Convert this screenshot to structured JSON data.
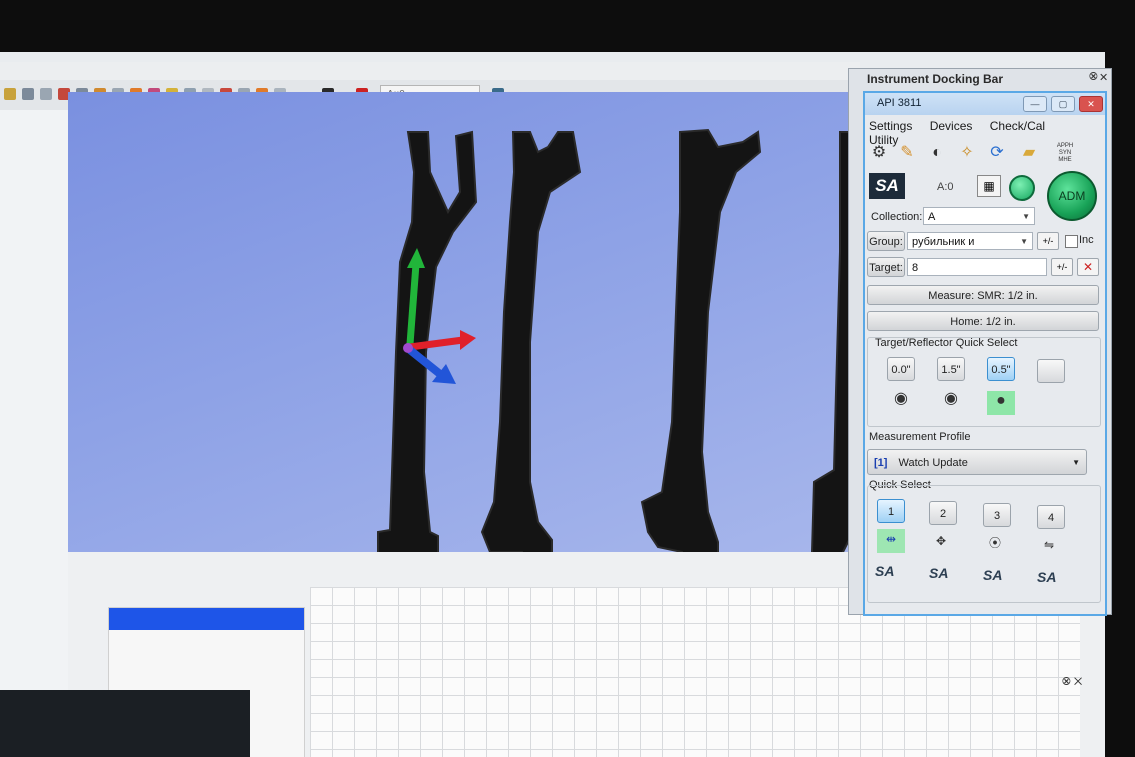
{
  "dock": {
    "title": "Instrument Docking Bar",
    "pin_glyph": "⮿",
    "close_glyph": "✕"
  },
  "instrument": {
    "title": "API 3811",
    "menu": [
      "Settings",
      "Devices",
      "Check/Cal",
      "Utility"
    ],
    "icons": [
      "gear-icon",
      "ruler-icon",
      "tracker-icon",
      "probe-icon",
      "refresh-icon",
      "folder-icon",
      "text-icon"
    ],
    "text_icon_lines": [
      "APPH",
      "SYN",
      "MHE"
    ],
    "sa_logo": "SA",
    "status": "A:0",
    "adm_label": "ADM",
    "collection_label": "Collection:",
    "collection_value": "A",
    "group_label": "Group:",
    "group_value": "рубильник и",
    "group_inc_label": "Inc",
    "target_label": "Target:",
    "target_value": "8",
    "plus_minus": "+/-",
    "measure_button": "Measure: SMR: 1/2 in.",
    "home_button": "Home: 1/2 in.",
    "target_reflector_label": "Target/Reflector Quick Select",
    "reflector_buttons": [
      "0.0\"",
      "1.5\"",
      "0.5\"",
      ""
    ],
    "selected_reflector": "0.5\"",
    "measurement_profile_label": "Measurement Profile",
    "profile_index": "[1]",
    "profile_value": "Watch Update",
    "quick_select_label": "Quick Select",
    "quick_select_buttons": [
      "1",
      "2",
      "3",
      "4"
    ],
    "selected_quick": "1"
  },
  "toolbar": {
    "field_value": "A::0"
  },
  "colors": {
    "viewport_top": "#7a90e0",
    "part_fill": "#141414",
    "axis_x": "#e0202a",
    "axis_y": "#21b53a",
    "axis_z": "#2255d8",
    "table_header": "#1e55e8",
    "adm_green": "#18a257"
  }
}
